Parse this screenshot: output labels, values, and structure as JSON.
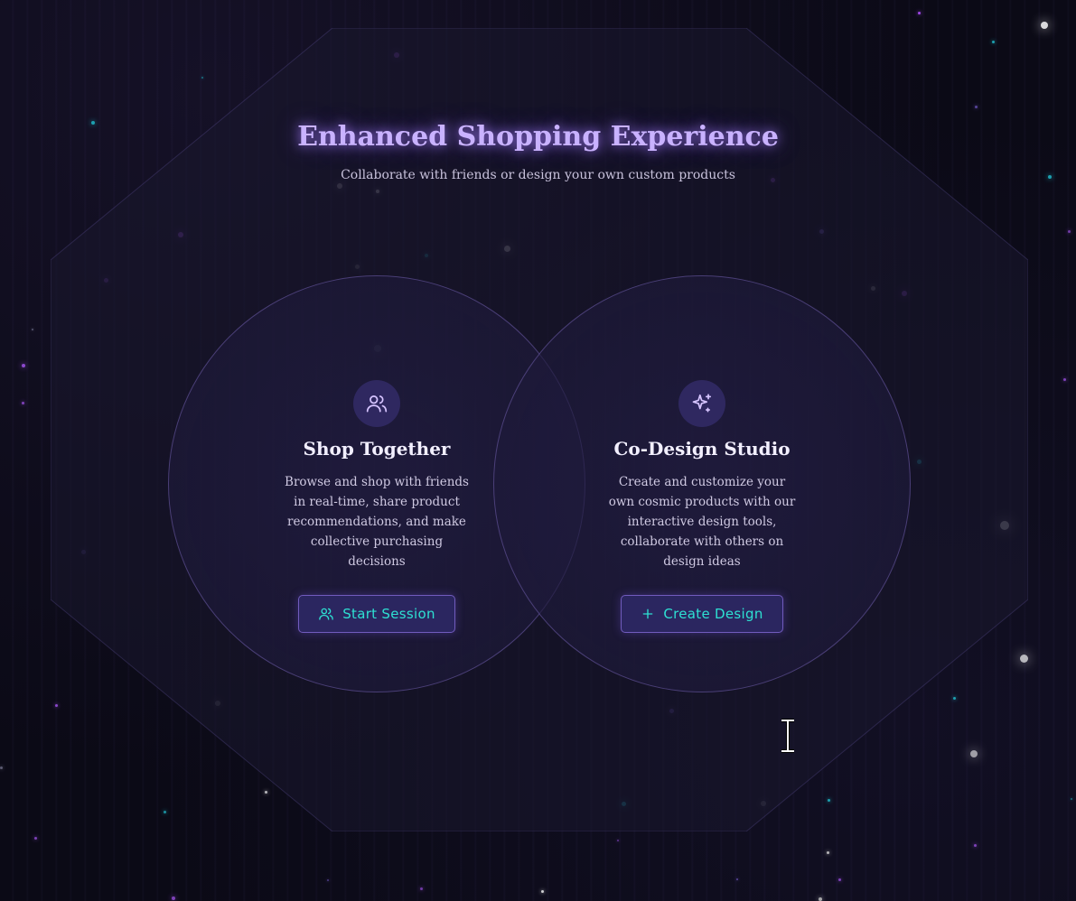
{
  "hero": {
    "title": "Enhanced Shopping Experience",
    "subtitle": "Collaborate with friends or design your own custom products"
  },
  "cards": [
    {
      "icon": "users-icon",
      "title": "Shop Together",
      "description": "Browse and shop with friends in real-time, share product recommendations, and make collective purchasing decisions",
      "button_icon": "users-icon",
      "button_label": "Start Session"
    },
    {
      "icon": "sparkles-icon",
      "title": "Co-Design Studio",
      "description": "Create and customize your own cosmic products with our interactive design tools, collaborate with others on design ideas",
      "button_icon": "plus-icon",
      "button_label": "Create Design"
    }
  ],
  "colors": {
    "background": "#0b0a16",
    "title_glow": "#c9b2ff",
    "button_text": "#2ee0d2",
    "button_bg": "#2b2660",
    "icon_bg": "#2f2860"
  }
}
